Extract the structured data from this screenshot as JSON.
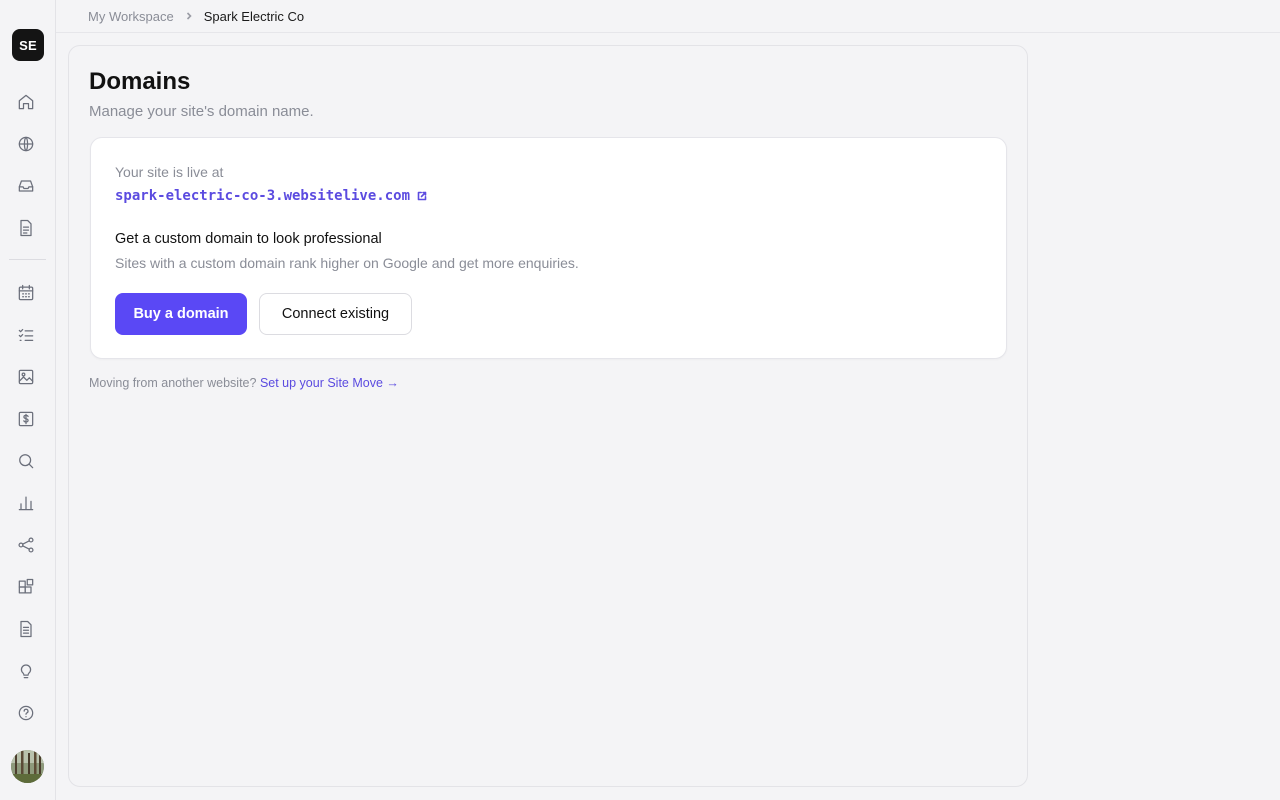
{
  "sidebar": {
    "workspace_initials": "SE",
    "icons": [
      "home-icon",
      "globe-icon",
      "inbox-icon",
      "document-icon",
      "calendar-icon",
      "checklist-icon",
      "image-icon",
      "dollar-icon",
      "search-icon",
      "bar-chart-icon",
      "share-icon",
      "apps-icon",
      "file-text-icon",
      "lightbulb-icon",
      "help-icon"
    ]
  },
  "breadcrumb": {
    "parent": "My Workspace",
    "current": "Spark Electric Co"
  },
  "page": {
    "title": "Domains",
    "subtitle": "Manage your site's domain name."
  },
  "domain_card": {
    "live_label": "Your site is live at",
    "live_url": "spark-electric-co-3.websitelive.com",
    "promo_title": "Get a custom domain to look professional",
    "promo_desc": "Sites with a custom domain rank higher on Google and get more enquiries.",
    "buy_label": "Buy a domain",
    "connect_label": "Connect existing"
  },
  "footer": {
    "note": "Moving from another website?",
    "link": "Set up your Site Move →"
  },
  "colors": {
    "accent": "#5a48f5",
    "link": "#5b4be0",
    "muted": "#8a8d97",
    "background": "#f4f4f6"
  }
}
